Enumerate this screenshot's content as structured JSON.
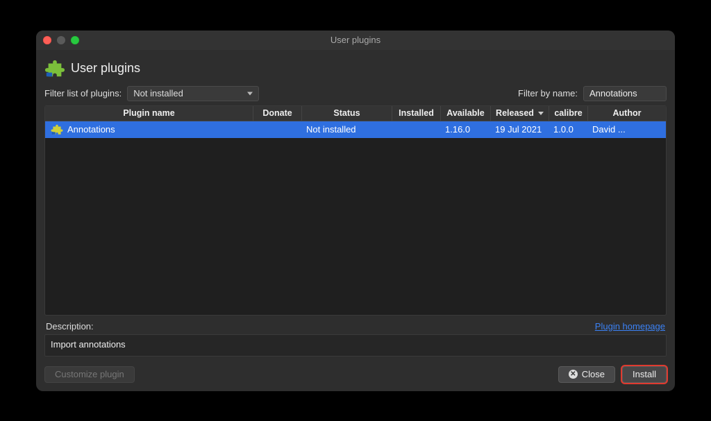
{
  "window": {
    "title": "User plugins"
  },
  "page": {
    "heading": "User plugins"
  },
  "filters": {
    "list_label": "Filter list of plugins:",
    "list_value": "Not installed",
    "name_label": "Filter by name:",
    "name_value": "Annotations"
  },
  "table": {
    "columns": [
      {
        "key": "name",
        "label": "Plugin name"
      },
      {
        "key": "donate",
        "label": "Donate"
      },
      {
        "key": "status",
        "label": "Status"
      },
      {
        "key": "installed",
        "label": "Installed"
      },
      {
        "key": "available",
        "label": "Available"
      },
      {
        "key": "released",
        "label": "Released",
        "sort": "desc"
      },
      {
        "key": "calibre",
        "label": "calibre"
      },
      {
        "key": "author",
        "label": "Author"
      }
    ],
    "rows": [
      {
        "name": "Annotations",
        "donate": "",
        "status": "Not installed",
        "installed": "",
        "available": "1.16.0",
        "released": "19 Jul 2021",
        "calibre": "1.0.0",
        "author": "David ...",
        "selected": true
      }
    ]
  },
  "description": {
    "label": "Description:",
    "value": "Import annotations",
    "homepage_link": "Plugin homepage"
  },
  "buttons": {
    "customize": "Customize plugin",
    "close": "Close",
    "install": "Install"
  },
  "icons": {
    "puzzle": "puzzle-icon",
    "close_circle": "close-circle-icon"
  }
}
